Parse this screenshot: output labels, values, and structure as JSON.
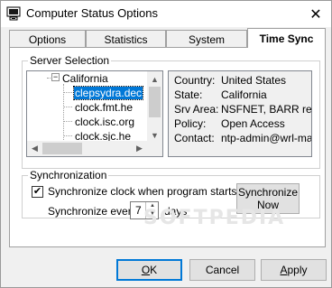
{
  "window": {
    "title": "Computer Status Options",
    "close_glyph": "✕"
  },
  "tabs": [
    {
      "label": "Options",
      "active": false
    },
    {
      "label": "Statistics",
      "active": false
    },
    {
      "label": "System",
      "active": false
    },
    {
      "label": "Time Sync",
      "active": true
    }
  ],
  "server_selection": {
    "legend": "Server Selection",
    "tree": {
      "parent": {
        "label": "California",
        "expander": "−"
      },
      "children": [
        "clepsydra.dec",
        "clock.fmt.he",
        "clock.isc.org",
        "clock.sjc.he"
      ],
      "selected": "clepsydra.dec"
    },
    "details": [
      {
        "label": "Country:",
        "value": "United States"
      },
      {
        "label": "State:",
        "value": "California"
      },
      {
        "label": "Srv Area:",
        "value": "NSFNET, BARR region"
      },
      {
        "label": "Policy:",
        "value": "Open Access"
      },
      {
        "label": "Contact:",
        "value": "ntp-admin@wrl-mail.hp"
      }
    ]
  },
  "synchronization": {
    "legend": "Synchronization",
    "checkbox_label": "Synchronize clock when program starts?",
    "checked": true,
    "check_glyph": "✔",
    "every_prefix": "Synchronize every",
    "every_value": "7",
    "every_suffix": "days",
    "sync_now_line1": "Synchronize",
    "sync_now_line2": "Now"
  },
  "buttons": {
    "ok_underlined": "O",
    "ok_rest": "K",
    "cancel": "Cancel",
    "apply_underlined": "A",
    "apply_rest": "pply"
  },
  "watermark": "SOFTPEDIA"
}
